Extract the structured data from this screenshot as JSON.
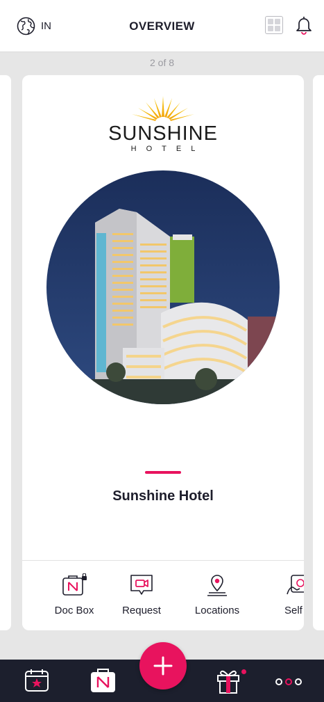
{
  "header": {
    "region_code": "IN",
    "title": "OVERVIEW"
  },
  "pager": {
    "text": "2 of 8"
  },
  "card": {
    "logo": {
      "word": "SUNSHINE",
      "sub": "HOTEL"
    },
    "hotel_name": "Sunshine Hotel",
    "actions": [
      {
        "label": "Doc Box",
        "icon": "doc-box-icon"
      },
      {
        "label": "Request",
        "icon": "video-request-icon"
      },
      {
        "label": "Locations",
        "icon": "location-pin-icon"
      },
      {
        "label": "Self S",
        "icon": "self-service-icon"
      }
    ]
  },
  "bottom_nav": {
    "items": [
      "calendar-star-icon",
      "doc-box-icon",
      "add-icon",
      "gift-icon",
      "more-icon"
    ]
  },
  "colors": {
    "accent": "#e8135e",
    "nav_bg": "#1c1f2d",
    "page_bg": "#e6e6e6"
  }
}
